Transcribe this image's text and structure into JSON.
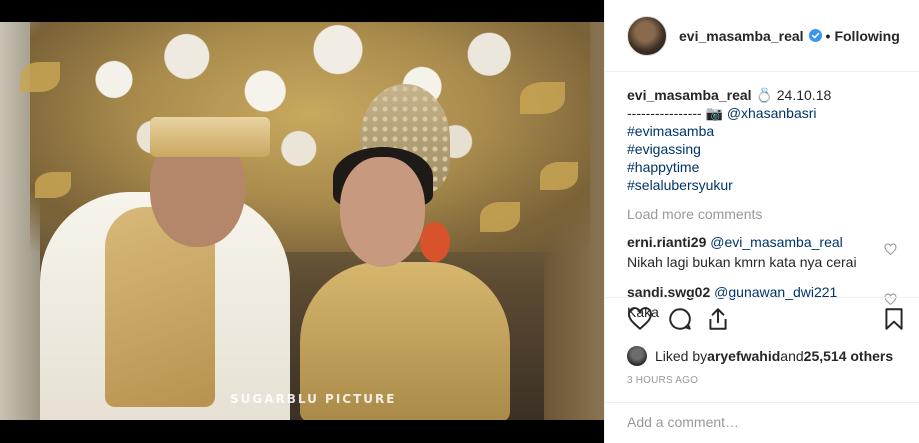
{
  "media": {
    "watermark": "SUGARBLU PICTURE"
  },
  "header": {
    "username": "evi_masamba_real",
    "separator": "•",
    "follow_status": "Following"
  },
  "caption": {
    "username": "evi_masamba_real",
    "ring_emoji": "💍",
    "date": "24.10.18",
    "dashes": "----------------",
    "camera_emoji": "📷",
    "credit": "@xhasanbasri",
    "hashtags": [
      "#evimasamba",
      "#evigassing",
      "#happytime",
      "#selalubersyukur"
    ]
  },
  "load_more": "Load more comments",
  "comments": [
    {
      "username": "erni.rianti29",
      "mention": "@evi_masamba_real",
      "text": " Nikah lagi bukan kmrn kata nya cerai"
    },
    {
      "username": "sandi.swg02",
      "mention": "@gunawan_dwi221",
      "text": " Kaka"
    }
  ],
  "likes": {
    "prefix": "Liked by ",
    "user": "aryefwahid",
    "middle": " and ",
    "count": "25,514 others"
  },
  "timestamp": "3 HOURS AGO",
  "add_comment": {
    "placeholder": "Add a comment…"
  },
  "icons": {
    "like": "heart-icon",
    "comment": "comment-icon",
    "share": "share-icon",
    "save": "bookmark-icon",
    "verified": "verified-badge-icon"
  },
  "colors": {
    "verified": "#3897f0",
    "link": "#003569",
    "muted": "#999999"
  }
}
